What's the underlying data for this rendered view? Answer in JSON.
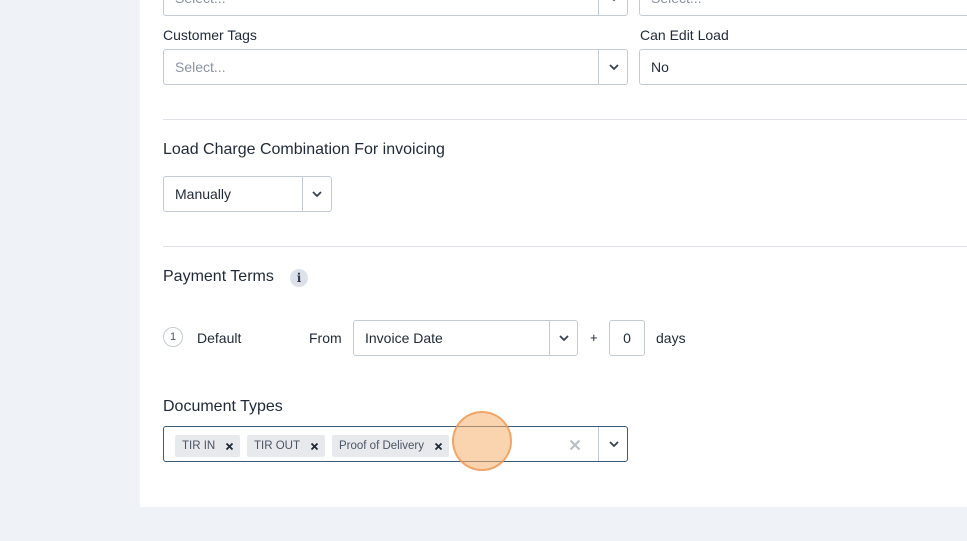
{
  "top_row": {
    "left_placeholder": "Select...",
    "right_placeholder": "Select..."
  },
  "customer_tags": {
    "label": "Customer Tags",
    "placeholder": "Select..."
  },
  "can_edit_load": {
    "label": "Can Edit Load",
    "value": "No"
  },
  "load_charge": {
    "title": "Load Charge Combination For invoicing",
    "value": "Manually"
  },
  "payment_terms": {
    "title": "Payment Terms",
    "info_icon": "info-icon",
    "row": {
      "number": "1",
      "name": "Default",
      "from_label": "From",
      "from_value": "Invoice Date",
      "plus": "+",
      "days_value": "0",
      "days_label": "days"
    }
  },
  "document_types": {
    "title": "Document Types",
    "tags": [
      "TIR IN",
      "TIR OUT",
      "Proof of Delivery"
    ]
  },
  "colors": {
    "page_bg": "#eff2f7",
    "panel_bg": "#ffffff",
    "border": "#c5cbd3",
    "focus_border": "#3b5b7a",
    "tag_bg": "#e7e9ec",
    "cursor": "#f6b06e"
  }
}
